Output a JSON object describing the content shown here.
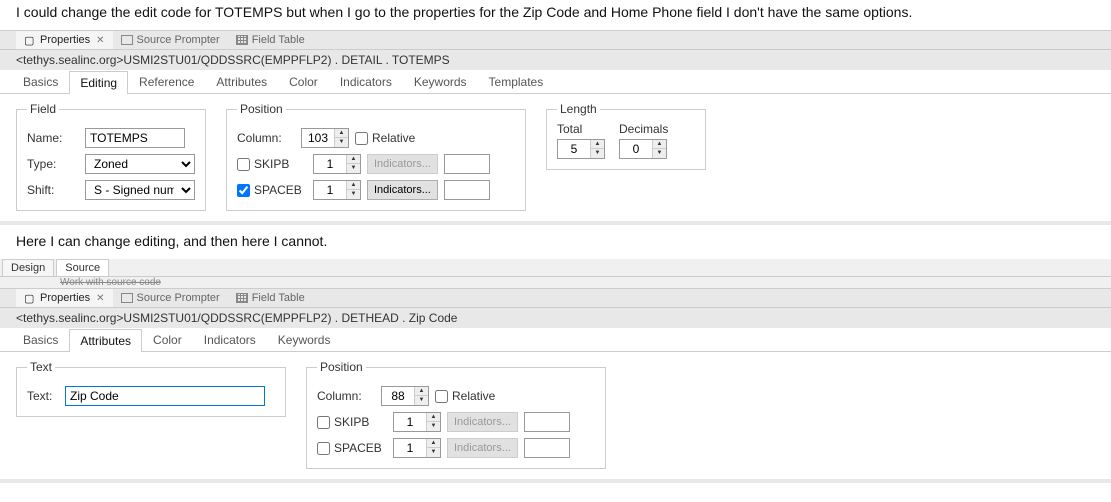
{
  "prose1": "I could change the edit code for TOTEMPS but when I go to the properties for the Zip Code and Home Phone field I don't have the same options.",
  "prose2": "Here I can change editing, and then here I cannot.",
  "panelTabs": {
    "properties": "Properties",
    "sourcePrompter": "Source Prompter",
    "fieldTable": "Field Table"
  },
  "breadcrumb1": "<tethys.sealinc.org>USMI2STU01/QDDSSRC(EMPPFLP2)  .  DETAIL  .  TOTEMPS",
  "breadcrumb2": "<tethys.sealinc.org>USMI2STU01/QDDSSRC(EMPPFLP2)  .  DETHEAD  .  Zip Code",
  "wsTabs1": [
    "Basics",
    "Editing",
    "Reference",
    "Attributes",
    "Color",
    "Indicators",
    "Keywords",
    "Templates"
  ],
  "wsTabs2": [
    "Basics",
    "Attributes",
    "Color",
    "Indicators",
    "Keywords"
  ],
  "dsTabs": {
    "design": "Design",
    "source": "Source"
  },
  "wws": "Work with source code",
  "field": {
    "legend": "Field",
    "nameLabel": "Name:",
    "nameValue": "TOTEMPS",
    "typeLabel": "Type:",
    "typeValue": "Zoned",
    "shiftLabel": "Shift:",
    "shiftValue": "S - Signed numer"
  },
  "position": {
    "legend": "Position",
    "columnLabel": "Column:",
    "columnValue1": "103",
    "columnValue2": "88",
    "relativeLabel": "Relative",
    "skipbLabel": "SKIPB",
    "skipbValue": "1",
    "spacebLabel": "SPACEB",
    "spacebValue": "1",
    "indicators": "Indicators..."
  },
  "length": {
    "legend": "Length",
    "totalLabel": "Total",
    "totalValue": "5",
    "decimalsLabel": "Decimals",
    "decimalsValue": "0"
  },
  "text": {
    "legend": "Text",
    "label": "Text:",
    "value": "Zip Code"
  }
}
